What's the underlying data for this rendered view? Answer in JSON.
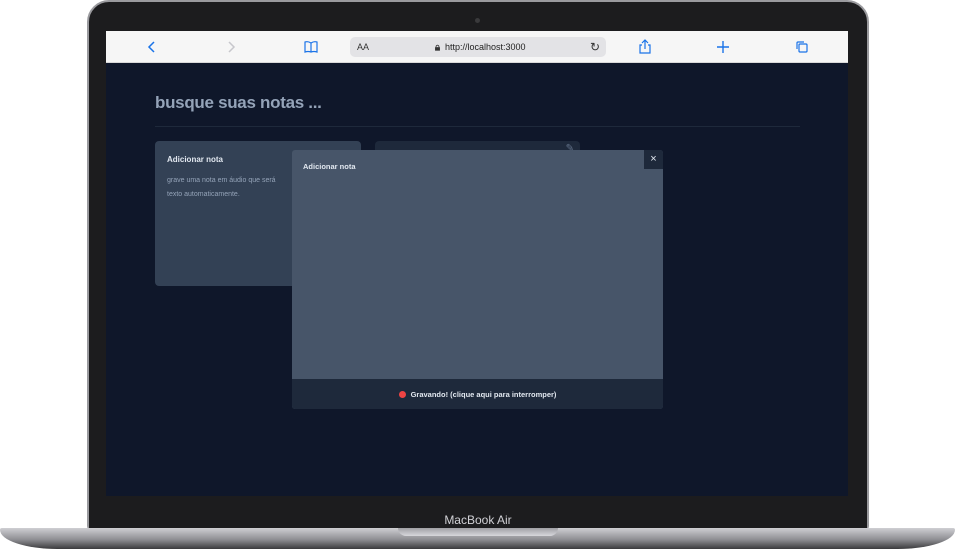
{
  "device": {
    "label": "MacBook Air"
  },
  "browser": {
    "text_size_label": "AA",
    "url": "http://localhost:3000",
    "icons": [
      "back-icon",
      "forward-icon",
      "bookmarks-icon",
      "lock-icon",
      "reload-icon",
      "share-icon",
      "new-tab-icon",
      "tabs-icon"
    ]
  },
  "app": {
    "search_title": "busque suas notas ...",
    "add_card": {
      "title": "Adicionar nota",
      "text_line1": "grave uma nota em áudio que será",
      "text_line2": "texto automaticamente."
    },
    "modal": {
      "title": "Adicionar nota",
      "close_label": "×",
      "recording_label": "Gravando! (clique aqui para interromper)"
    }
  },
  "colors": {
    "background": "#0f172a",
    "card": "#334155",
    "modal": "#475569",
    "footer": "#1e293b",
    "recording": "#ef4444",
    "browser_accent": "#1a73e8"
  }
}
